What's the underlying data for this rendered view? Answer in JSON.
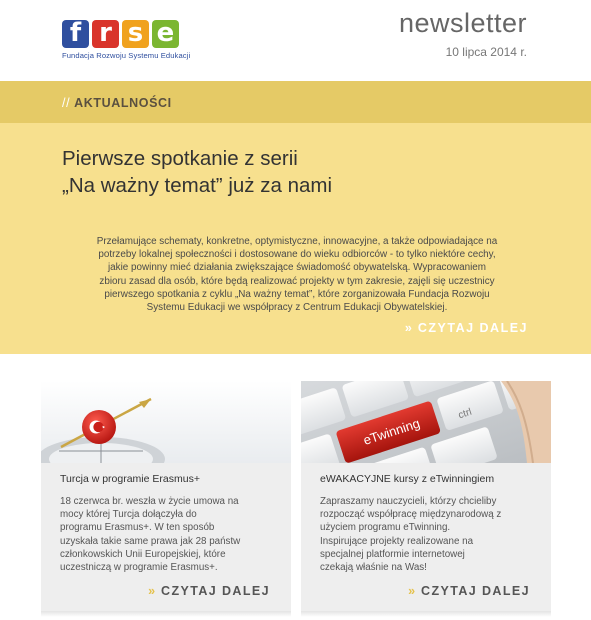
{
  "header": {
    "logo_letters": [
      "f",
      "r",
      "s",
      "e"
    ],
    "logo_colors": [
      "#2f4f9f",
      "#d9342b",
      "#f0a21e",
      "#7bb631"
    ],
    "logo_subtitle": "Fundacja Rozwoju Systemu Edukacji",
    "title": "newsletter",
    "date": "10 lipca 2014 r."
  },
  "feature": {
    "section_slashes": "//",
    "section_label": "AKTUALNOŚCI",
    "headline_line1": "Pierwsze spotkanie z serii",
    "headline_line2": "„Na ważny temat” już za nami",
    "lead_lines": [
      "Przełamujące schematy, konkretne, optymistyczne, innowacyjne, a także odpowiadające na",
      "potrzeby lokalnej społeczności i dostosowane do wieku odbiorców - to tylko niektóre cechy,",
      "jakie powinny mieć działania zwiększające świadomość obywatelską. Wypracowaniem",
      "zbioru zasad dla osób, które będą realizować projekty w tym zakresie, zajęli się uczestnicy",
      "pierwszego spotkania z cyklu „Na ważny temat”, które zorganizowała Fundacja Rozwoju",
      "Systemu Edukacji we współpracy z Centrum Edukacji Obywatelskiej."
    ],
    "read_more_arrow": "»",
    "read_more": "CZYTAJ DALEJ",
    "colors": {
      "band_top": "#e5ca66",
      "band_body": "#f7e08e"
    }
  },
  "cards": [
    {
      "title": "Turcja w programie Erasmus+",
      "text_lines": [
        "18 czerwca br. weszła w życie umowa na",
        "mocy której Turcja dołączyła do",
        "programu Erasmus+. W ten sposób",
        "uzyskała takie same prawa jak 28 państw",
        "członkowskich Unii Europejskiej, które",
        "uczestniczą w programie Erasmus+."
      ],
      "read_more_arrow": "»",
      "read_more": "CZYTAJ DALEJ",
      "image_icon": "compass-turkey-flag-icon"
    },
    {
      "title": "eWAKACYJNE kursy z eTwinningiem",
      "text_lines": [
        "Zapraszamy nauczycieli, którzy chcieliby",
        "rozpocząć współpracę międzynarodową z",
        "użyciem programu eTwinning.",
        "Inspirujące projekty realizowane na",
        "specjalnej platformie internetowej",
        "czekają właśnie na Was!"
      ],
      "read_more_arrow": "»",
      "read_more": "CZYTAJ DALEJ",
      "image_icon": "keyboard-etwinning-key-icon",
      "key_label": "eTwinning",
      "key_small_label": "ctrl"
    }
  ]
}
